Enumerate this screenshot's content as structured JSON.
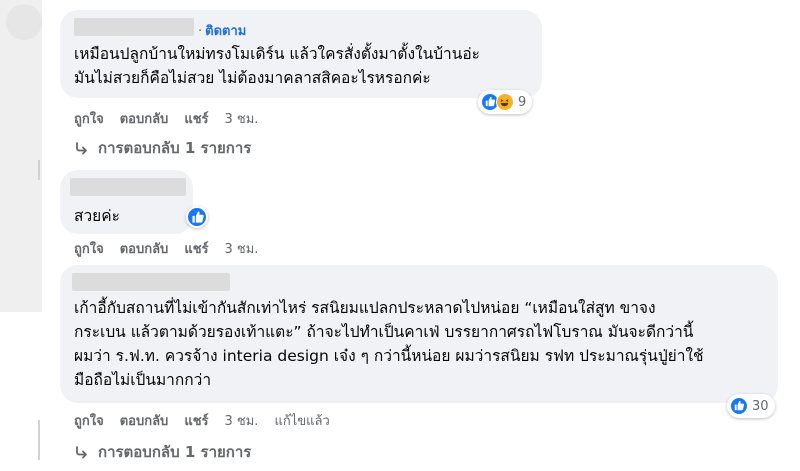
{
  "comments": [
    {
      "follow_label": "ติดตาม",
      "follow_dot": "·",
      "lines": [
        "เหมือนปลูกบ้านใหม่ทรงโมเดิร์น แล้วใครสั่งตั้งมาตั้งในบ้านอ่ะ",
        "มันไม่สวยก็คือไม่สวย ไม่ต้องมาคลาสสิคอะไรหรอกค่ะ"
      ],
      "reaction_icons": [
        "like-icon",
        "haha-icon"
      ],
      "reaction_count": "9",
      "actions": {
        "like": "ถูกใจ",
        "reply": "ตอบกลับ",
        "share": "แชร์",
        "time": "3 ชม."
      },
      "replies_label": "การตอบกลับ 1 รายการ"
    },
    {
      "lines": [
        "สวยค่ะ"
      ],
      "reaction_icons": [
        "like-icon"
      ],
      "actions": {
        "like": "ถูกใจ",
        "reply": "ตอบกลับ",
        "share": "แชร์",
        "time": "3 ชม."
      }
    },
    {
      "lines": [
        "เก้าอี้กับสถานที่ไม่เข้ากันสักเท่าไหร่ รสนิยมแปลกประหลาดไปหน่อย “เหมือนใส่สูท ขาจง",
        "กระเบน แล้วตามด้วยรองเท้าแตะ” ถ้าจะไปทำเป็นคาเฟ่ บรรยากาศรถไฟโบราณ มันจะดีกว่านี้",
        "ผมว่า ร.ฟ.ท. ควรจ้าง interia design เจ๋ง ๆ กว่านี้หน่อย ผมว่ารสนิยม รฟท ประมาณรุ่นปู่ย่าใช้",
        "มือถือไม่เป็นมากกว่า"
      ],
      "reaction_icons": [
        "like-icon"
      ],
      "reaction_count": "30",
      "actions": {
        "like": "ถูกใจ",
        "reply": "ตอบกลับ",
        "share": "แชร์",
        "time": "3 ชม.",
        "edited": "แก้ไขแล้ว"
      },
      "replies_label": "การตอบกลับ 1 รายการ"
    }
  ],
  "colors": {
    "bubble": "#f0f2f5",
    "link": "#216fdb",
    "secondary_text": "#65676b",
    "like": "#1877f2",
    "haha": "#f7b125"
  }
}
